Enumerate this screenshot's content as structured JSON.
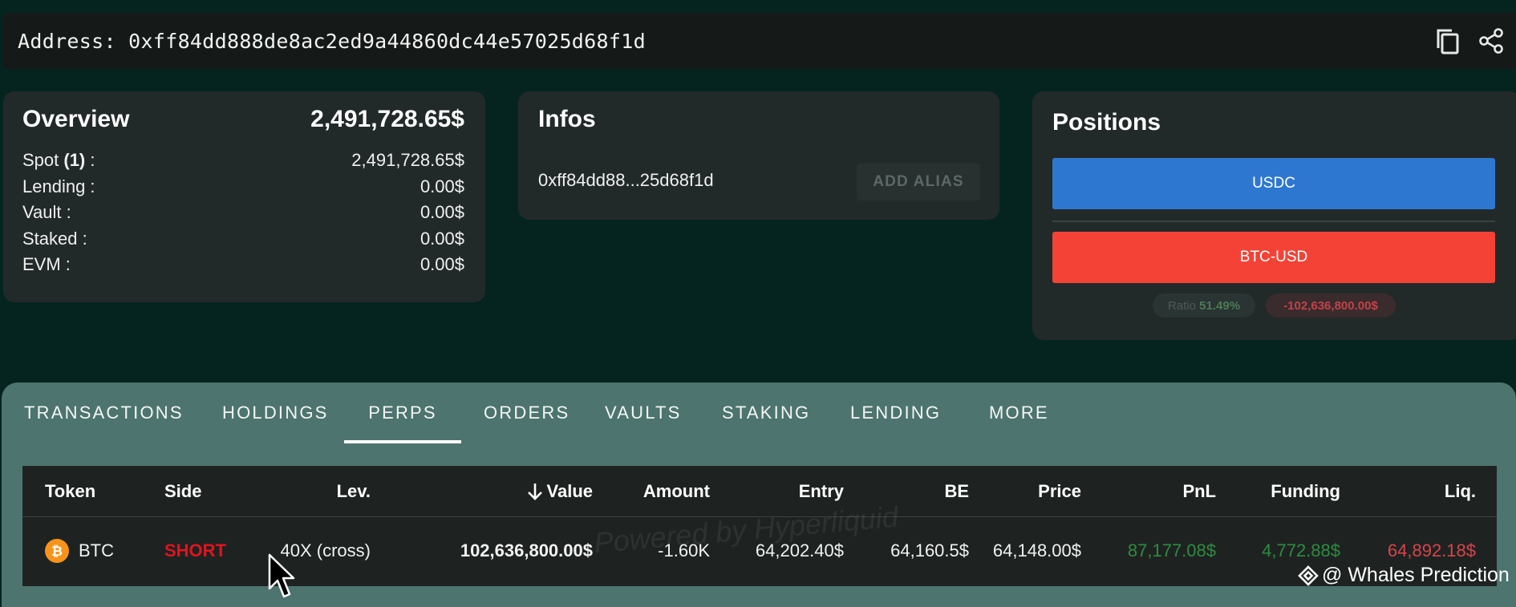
{
  "address_bar": {
    "text": "Address: 0xff84dd888de8ac2ed9a44860dc44e57025d68f1d",
    "copy_icon": "copy-icon",
    "share_icon": "share-icon"
  },
  "overview": {
    "title": "Overview",
    "total": "2,491,728.65$",
    "rows": [
      {
        "label_pre": "Spot ",
        "label_bold": "(1)",
        "label_post": " :",
        "value": "2,491,728.65$"
      },
      {
        "label_pre": "Lending :",
        "label_bold": "",
        "label_post": "",
        "value": "0.00$"
      },
      {
        "label_pre": "Vault :",
        "label_bold": "",
        "label_post": "",
        "value": "0.00$"
      },
      {
        "label_pre": "Staked :",
        "label_bold": "",
        "label_post": "",
        "value": "0.00$"
      },
      {
        "label_pre": "EVM :",
        "label_bold": "",
        "label_post": "",
        "value": "0.00$"
      }
    ]
  },
  "infos": {
    "title": "Infos",
    "short_address": "0xff84dd88...25d68f1d",
    "add_alias_label": "ADD ALIAS"
  },
  "positions": {
    "title": "Positions",
    "usdc_label": "USDC",
    "usdc_color": "#2e77d0",
    "btc_label": "BTC-USD",
    "btc_color": "#f44336",
    "ratio_label": "Ratio",
    "ratio_value": "51.49%",
    "delta_value": "-102,636,800.00$"
  },
  "tabs": [
    {
      "label": "TRANSACTIONS"
    },
    {
      "label": "HOLDINGS"
    },
    {
      "label": "PERPS",
      "active": true
    },
    {
      "label": "ORDERS"
    },
    {
      "label": "VAULTS"
    },
    {
      "label": "STAKING"
    },
    {
      "label": "LENDING"
    },
    {
      "label": "MORE"
    }
  ],
  "table": {
    "headers": {
      "token": "Token",
      "side": "Side",
      "lev": "Lev.",
      "value": "Value",
      "amount": "Amount",
      "entry": "Entry",
      "be": "BE",
      "price": "Price",
      "pnl": "PnL",
      "funding": "Funding",
      "liq": "Liq."
    },
    "sort_icon": "arrow-down-icon",
    "rows": [
      {
        "token_icon": "bitcoin-icon",
        "token": "BTC",
        "side": "SHORT",
        "lev": "40X (cross)",
        "value": "102,636,800.00$",
        "amount": "-1.60K",
        "entry": "64,202.40$",
        "be": "64,160.5$",
        "price": "64,148.00$",
        "pnl": "87,177.08$",
        "funding": "4,772.88$",
        "liq": "64,892.18$"
      }
    ],
    "colors": {
      "short": "#e0141e",
      "positive": "#2e8b3e",
      "negative": "#d9434a"
    }
  },
  "watermark": "Powered by Hyperliquid",
  "brand": {
    "icon": "binance-diamond-icon",
    "text": "@ Whales Prediction"
  }
}
